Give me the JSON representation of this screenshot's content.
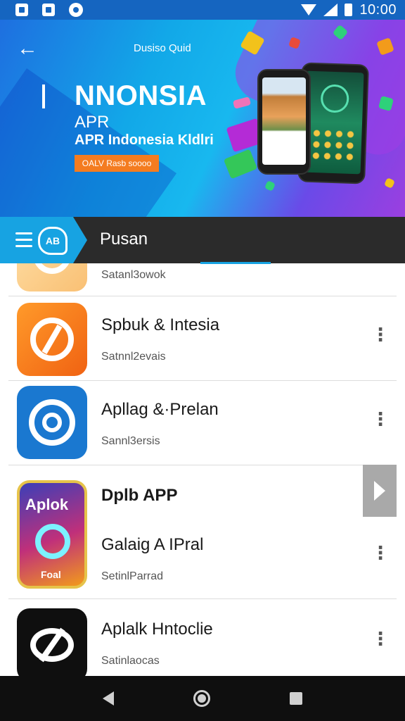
{
  "status_bar": {
    "time": "10:00"
  },
  "banner": {
    "caption": "Dusiso Quid",
    "title": "NNONSIA",
    "subtitle": "APR",
    "tagline": "APR Indonesia Kldlri",
    "cta": "OALV Rasb soooo"
  },
  "header": {
    "title": "Pusan"
  },
  "apps": [
    {
      "name": "",
      "category": "Satanl3owok"
    },
    {
      "name": "Spbuk & Intesia",
      "category": "Satnnl2evais"
    },
    {
      "name": "Apllag &·Prelan",
      "category": "Sannl3ersis"
    },
    {
      "heading": "Dplb APP",
      "name": "Galaig A IPral",
      "category": "SetinlParrad",
      "icon_text": "Aplok",
      "icon_footer": "Foal"
    },
    {
      "name": "Aplalk Hntoclie",
      "category": "Satinlaocas"
    }
  ],
  "colors": {
    "accent": "#17a3e2",
    "status_bar": "#1565c0",
    "header": "#2b2b2b"
  }
}
